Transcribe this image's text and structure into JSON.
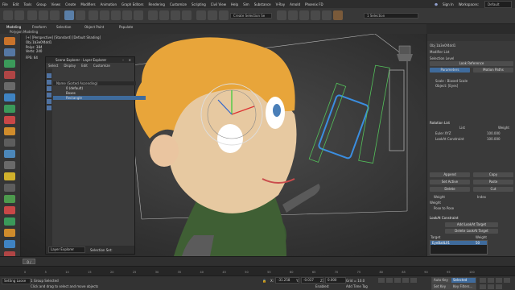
{
  "menubar": {
    "items": [
      "File",
      "Edit",
      "Tools",
      "Group",
      "Views",
      "Create",
      "Modifiers",
      "Animation",
      "Graph Editors",
      "Rendering",
      "Customize",
      "Scripting",
      "Civil View",
      "Help",
      "Sim",
      "Substance",
      "V-Ray",
      "Arnold",
      "Phoenix FD"
    ],
    "selection_set": "Create Selection Se",
    "select_label": "1 Selection",
    "signin": "Sign In",
    "workspaces": "Workspaces:",
    "workspace_value": "Default"
  },
  "ribbon": {
    "tabs": [
      "Modeling",
      "Freeform",
      "Selection",
      "Object Paint",
      "Populate"
    ],
    "sub_label": "Polygon Modeling"
  },
  "viewport": {
    "label": "[+] [Perspective] [Standard] [Default Shading]",
    "stats": {
      "object": "Obj 1b3e0f4dd1",
      "polys_label": "Polys:",
      "polys": "384",
      "verts_label": "Verts:",
      "verts": "240",
      "fps_label": "FPS:",
      "fps": "64"
    }
  },
  "scene_explorer": {
    "title": "Scene Explorer - Layer Explorer",
    "menu": [
      "Select",
      "Display",
      "Edit",
      "Customize"
    ],
    "column": "Name (Sorted Ascending)",
    "rows": [
      "0 (default)",
      "Boxes",
      "Rectangle"
    ],
    "footer_mode": "Layer Explorer",
    "footer_set": "Selection Set:"
  },
  "rightpanel": {
    "object_name": "Obj 1b3e0f4dd1",
    "modifier_list": "Modifier List",
    "selected_label": "Selection Level",
    "btn_look": "Look Reference",
    "btn_params": "Parameters",
    "btn_motion": "Motion Paths",
    "info1": "Scale : Biased Scale",
    "info2": "Object: [Eyes]",
    "rotation_list": "Rotation List",
    "col_list": "List",
    "col_weight": "Weight",
    "row1": "Euler XYZ",
    "row1_weight": "100.000",
    "row2": "LookAt Constraint",
    "row2_weight": "100.000",
    "btn_append": "Append",
    "btn_copy": "Copy",
    "btn_set_active": "Set Active",
    "btn_paste": "Paste",
    "btn_delete": "Delete",
    "btn_cut": "Cut",
    "weight_label": "Weight",
    "index_label": "Index",
    "pose_to_pose": "Pose to Pose",
    "lookat_section": "LookAt Constraint",
    "add_lookat": "Add LookAt Target",
    "delete_lookat": "Delete LookAt Target",
    "col_target": "Target",
    "col_target_weight": "Weight",
    "target_row": "EyeBallL01",
    "target_row_weight": "50"
  },
  "timeline": {
    "frame": "0 / 100",
    "ticks": [
      "0",
      "5",
      "10",
      "15",
      "20",
      "25",
      "30",
      "35",
      "40",
      "45",
      "50",
      "55",
      "60",
      "65",
      "70",
      "75",
      "80",
      "85",
      "90",
      "95",
      "100"
    ]
  },
  "statusbar": {
    "script_listener": "Setting Loose",
    "msg_top": "1 Group Selected",
    "msg_bottom": "Click and drag to select and move objects",
    "x_label": "X:",
    "x_val": "-31.258",
    "y_label": "Y:",
    "y_val": "-0.037",
    "z_label": "Z:",
    "z_val": "0.000",
    "grid": "Grid = 10.0",
    "autokey": "Auto Key",
    "selected": "Selected",
    "setkey": "Set Key",
    "keyfilters": "Key Filters...",
    "addtime": "Add Time Tag",
    "enabled": "Enabled:"
  }
}
